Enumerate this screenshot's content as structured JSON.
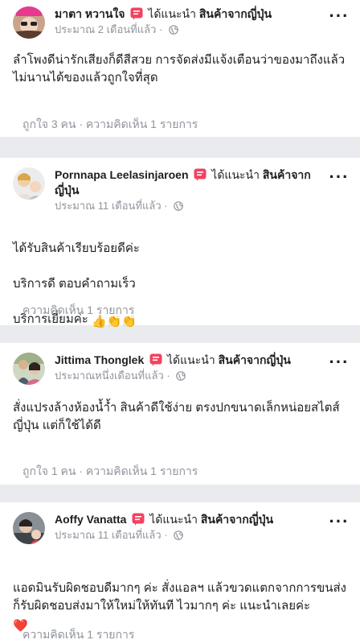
{
  "recommend_text": "ได้แนะนำ",
  "page_name": "สินค้าจากญี่ปุ่น",
  "colors": {
    "recommend_badge": "#f3425f",
    "divider": "#e9ebee",
    "muted": "#90949c"
  },
  "posts": [
    {
      "author": "มาตา หวานใจ",
      "time": "ประมาณ 2 เดือนที่แล้ว",
      "text": "ลำโพงดีน่ารักเสียงก็ดีสีสวย การจัดส่งมีแจ้งเตือนว่าของมาถึงแล้วไม่นานได้ของแล้วถูกใจที่สุด",
      "stats": "ถูกใจ 3 คน · ความคิดเห็น 1 รายการ"
    },
    {
      "author": "Pornnapa Leelasinjaroen",
      "time": "ประมาณ 11 เดือนที่แล้ว",
      "text_lines": [
        "ได้รับสินค้าเรียบร้อยดีค่ะ",
        "บริการดี ตอบคำถามเร็ว",
        "บริการเยี่ยมค่ะ"
      ],
      "text_emoji": "👍👏👏",
      "stats": "ความคิดเห็น 1 รายการ"
    },
    {
      "author": "Jittima Thonglek",
      "time": "ประมาณหนึ่งเดือนที่แล้ว",
      "text": "สั่งแปรงล้างห้องน้ำ้ำ สินค้าดีใช้ง่าย ตรงปกขนาดเล็กหน่อยสไตส์ญี่ปุ่น แต่ก็ใช้ได้ดี",
      "stats": "ถูกใจ 1 คน · ความคิดเห็น 1 รายการ"
    },
    {
      "author": "Aoffy Vanatta",
      "time": "ประมาณ 11 เดือนที่แล้ว",
      "text": "แอดมินรับผิดชอบดีมากๆ ค่ะ สั่งแอลฯ แล้วขวดแตกจากการขนส่งก็รับผิดชอบส่งมาให้ใหม่ให้ทันที ไวมากๆ ค่ะ แนะนำเลยค่ะ",
      "text_emoji": "❤️",
      "stats": "ความคิดเห็น 1 รายการ"
    }
  ]
}
